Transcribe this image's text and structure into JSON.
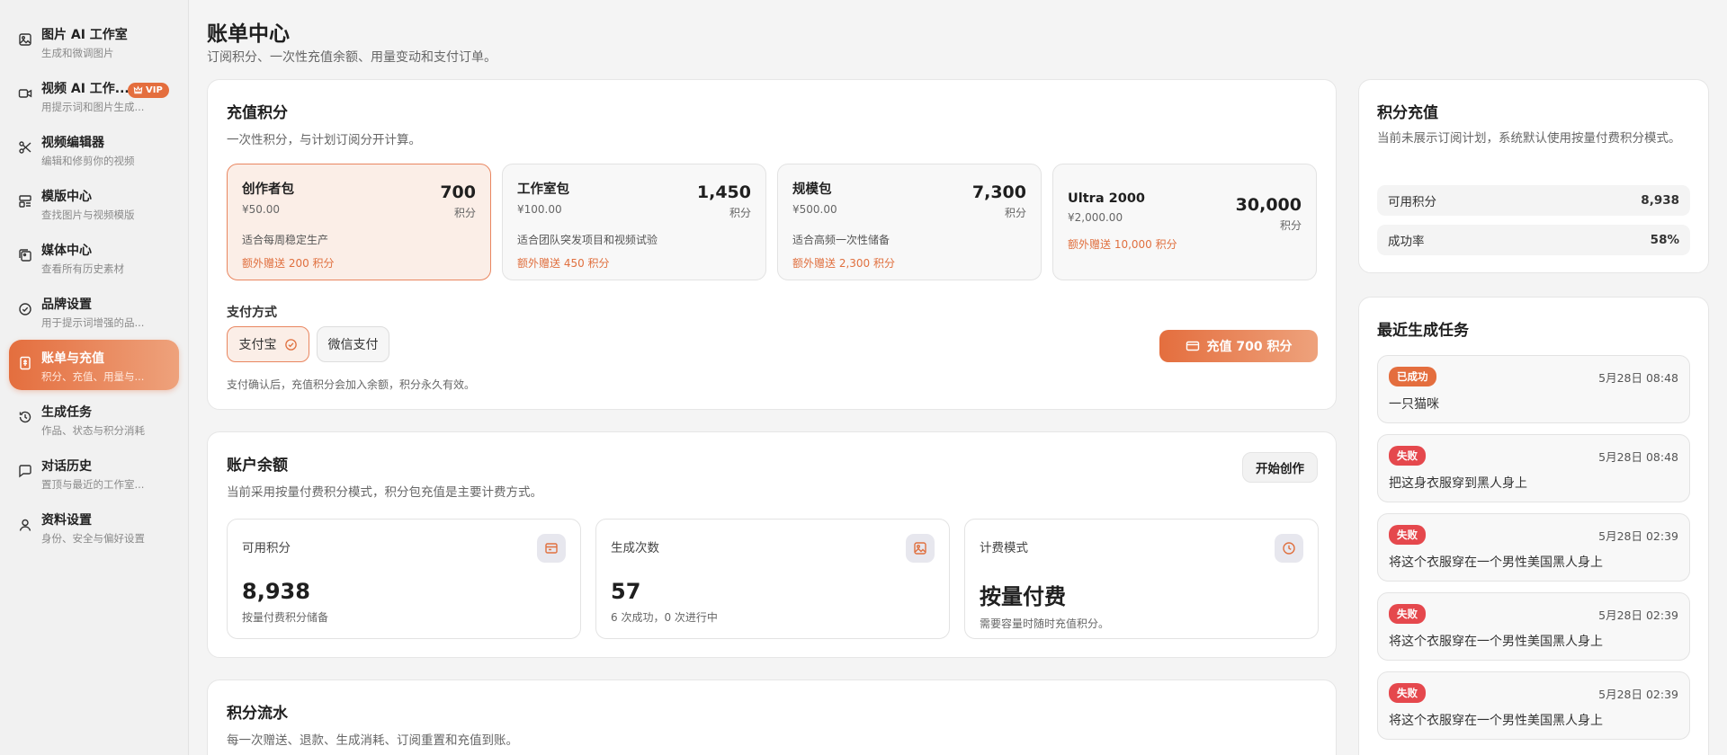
{
  "sidebar": {
    "items": [
      {
        "title": "图片 AI 工作室",
        "sub": "生成和微调图片",
        "icon": "image-icon"
      },
      {
        "title": "视频 AI 工作...",
        "sub": "用提示词和图片生成...",
        "icon": "video-icon",
        "badge": "VIP"
      },
      {
        "title": "视频编辑器",
        "sub": "编辑和修剪你的视频",
        "icon": "scissors-icon"
      },
      {
        "title": "模版中心",
        "sub": "查找图片与视频模版",
        "icon": "layout-icon"
      },
      {
        "title": "媒体中心",
        "sub": "查看所有历史素材",
        "icon": "gallery-icon"
      },
      {
        "title": "品牌设置",
        "sub": "用于提示词增强的品...",
        "icon": "check-circle-icon"
      },
      {
        "title": "账单与充值",
        "sub": "积分、充值、用量与...",
        "icon": "bill-icon",
        "active": true
      },
      {
        "title": "生成任务",
        "sub": "作品、状态与积分消耗",
        "icon": "history-icon"
      },
      {
        "title": "对话历史",
        "sub": "置顶与最近的工作室...",
        "icon": "chat-icon"
      },
      {
        "title": "资料设置",
        "sub": "身份、安全与偏好设置",
        "icon": "user-icon"
      }
    ]
  },
  "header": {
    "title": "账单中心",
    "subtitle": "订阅积分、一次性充值余额、用量变动和支付订单。"
  },
  "recharge": {
    "title": "充值积分",
    "subtitle": "一次性积分，与计划订阅分开计算。",
    "packages": [
      {
        "name": "创作者包",
        "price": "¥50.00",
        "credits": "700",
        "unit": "积分",
        "desc": "适合每周稳定生产",
        "bonus": "额外赠送 200 积分",
        "selected": true
      },
      {
        "name": "工作室包",
        "price": "¥100.00",
        "credits": "1,450",
        "unit": "积分",
        "desc": "适合团队突发项目和视频试验",
        "bonus": "额外赠送 450 积分"
      },
      {
        "name": "规模包",
        "price": "¥500.00",
        "credits": "7,300",
        "unit": "积分",
        "desc": "适合高频一次性储备",
        "bonus": "额外赠送 2,300 积分"
      },
      {
        "name": "Ultra 2000",
        "price": "¥2,000.00",
        "credits": "30,000",
        "unit": "积分",
        "desc": "",
        "bonus": "额外赠送 10,000 积分"
      }
    ],
    "payment_label": "支付方式",
    "payment_methods": [
      {
        "label": "支付宝",
        "selected": true
      },
      {
        "label": "微信支付"
      }
    ],
    "charge_button": "充值 700 积分",
    "note": "支付确认后，充值积分会加入余额，积分永久有效。"
  },
  "balance": {
    "title": "账户余额",
    "subtitle": "当前采用按量付费积分模式，积分包充值是主要计费方式。",
    "start_button": "开始创作",
    "stats": [
      {
        "label": "可用积分",
        "value": "8,938",
        "note": "按量付费积分储备",
        "icon": "wallet-icon"
      },
      {
        "label": "生成次数",
        "value": "57",
        "note": "6 次成功，0 次进行中",
        "icon": "image-icon"
      },
      {
        "label": "计费模式",
        "value": "按量付费",
        "note": "需要容量时随时充值积分。",
        "icon": "clock-icon"
      }
    ]
  },
  "ledger": {
    "title": "积分流水",
    "subtitle": "每一次赠送、退款、生成消耗、订阅重置和充值到账。"
  },
  "credits_panel": {
    "title": "积分充值",
    "subtitle": "当前未展示订阅计划，系统默认使用按量付费积分模式。",
    "rows": [
      {
        "label": "可用积分",
        "value": "8,938"
      },
      {
        "label": "成功率",
        "value": "58%"
      }
    ]
  },
  "tasks": {
    "title": "最近生成任务",
    "items": [
      {
        "status": "已成功",
        "kind": "ok",
        "time": "5月28日 08:48",
        "prompt": "一只猫咪"
      },
      {
        "status": "失败",
        "kind": "fail",
        "time": "5月28日 08:48",
        "prompt": "把这身衣服穿到黑人身上"
      },
      {
        "status": "失败",
        "kind": "fail",
        "time": "5月28日 02:39",
        "prompt": "将这个衣服穿在一个男性美国黑人身上"
      },
      {
        "status": "失败",
        "kind": "fail",
        "time": "5月28日 02:39",
        "prompt": "将这个衣服穿在一个男性美国黑人身上"
      },
      {
        "status": "失败",
        "kind": "fail",
        "time": "5月28日 02:39",
        "prompt": "将这个衣服穿在一个男性美国黑人身上"
      }
    ]
  },
  "colors": {
    "accent": "#e46e3e",
    "accent_light": "#eea27c",
    "fail": "#e5484d"
  }
}
